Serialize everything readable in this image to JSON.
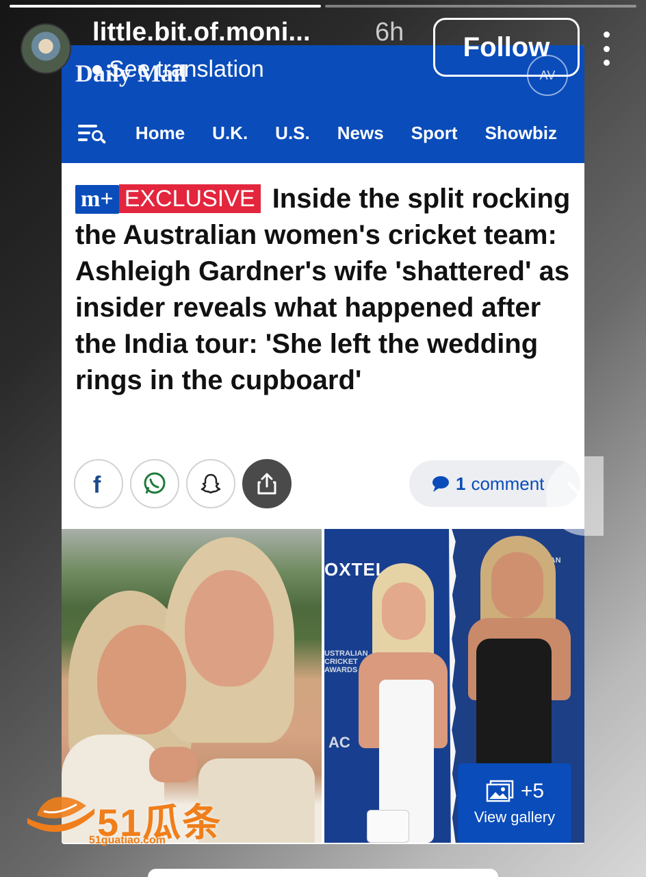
{
  "story": {
    "username": "little.bit.of.moni...",
    "time": "6h",
    "translation": "See translation",
    "follow_label": "Follow",
    "progress": [
      1.0,
      0.0
    ]
  },
  "article": {
    "brand": "Daily Mail",
    "av_badge": "AV",
    "nav": [
      "Home",
      "U.K.",
      "U.S.",
      "News",
      "Sport",
      "Showbiz"
    ],
    "badge_mplus": "m+",
    "badge_exclusive": "EXCLUSIVE",
    "headline": "Inside the split rocking the Australian women's cricket team: Ashleigh Gardner's wife 'shattered' as insider reveals what happened after the India tour: 'She left the wedding rings in the cupboard'",
    "comment_count": "1",
    "comment_label": "comment",
    "gallery_count": "+5",
    "gallery_label": "View gallery",
    "photo_text_oxtel": "OXTEL",
    "photo_text_aca": "USTRALIAN CRICKET AWARDS",
    "photo_text_ac": "AC"
  },
  "watermark": {
    "text": "51瓜条",
    "url": "51guatiao.com"
  },
  "colors": {
    "brand_blue": "#0a4cba",
    "exclusive_red": "#e3263d",
    "watermark_orange": "#f07e1a"
  },
  "icons": [
    "more-vertical-icon",
    "menu-search-icon",
    "facebook-icon",
    "whatsapp-icon",
    "snapchat-icon",
    "share-icon",
    "comment-bubble-icon",
    "gallery-icon",
    "chevron-right-icon"
  ]
}
